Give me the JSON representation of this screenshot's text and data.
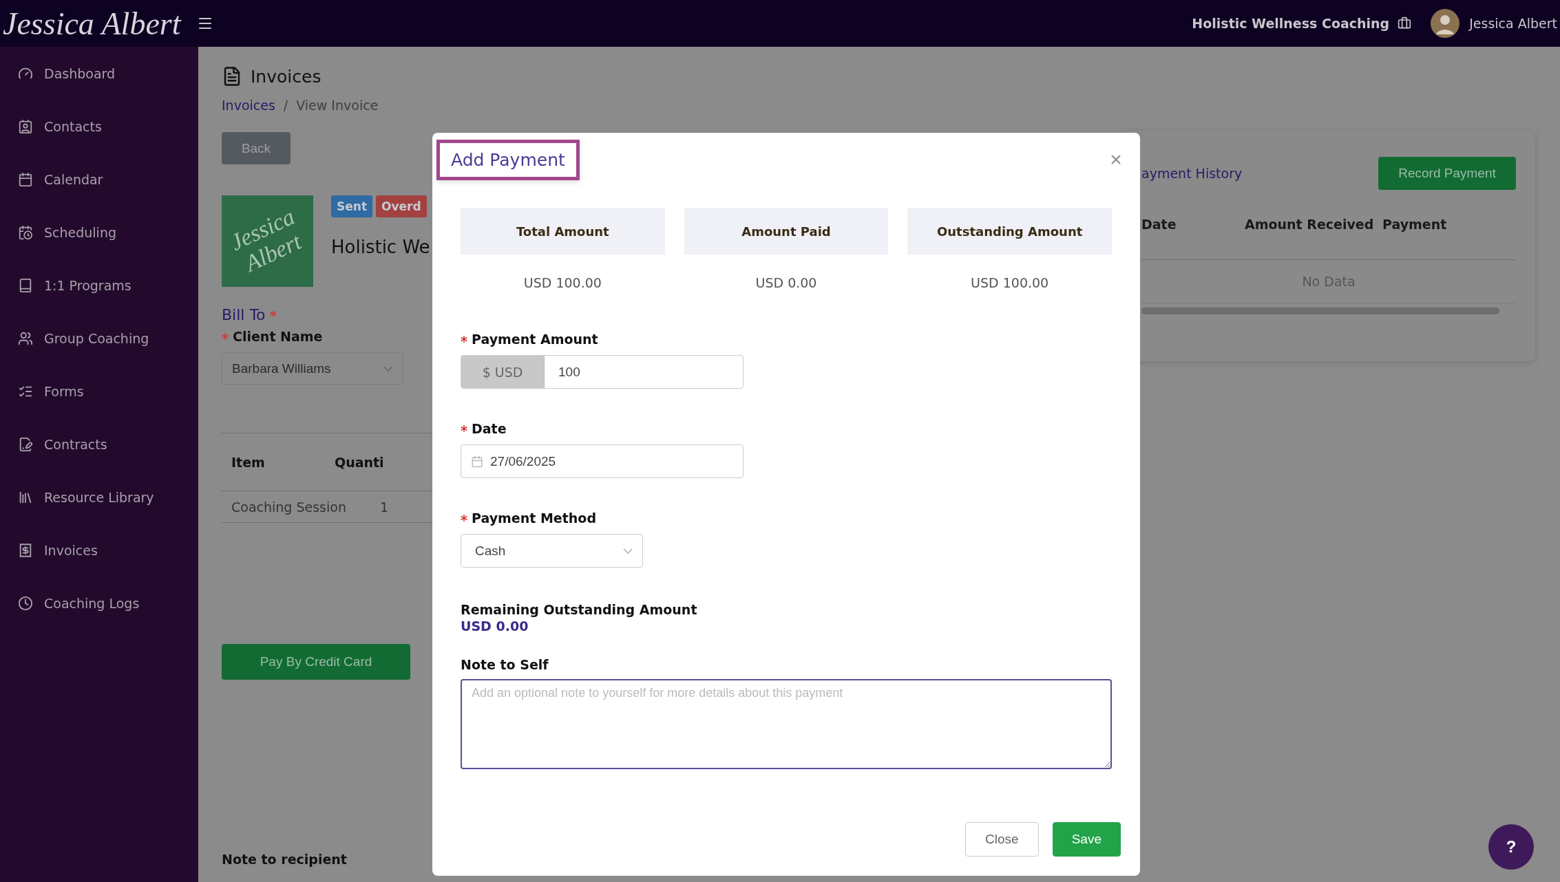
{
  "top_bar": {
    "logo": "Jessica Albert",
    "business": "Holistic Wellness Coaching",
    "user": "Jessica Albert"
  },
  "sidebar": {
    "items": [
      {
        "label": "Dashboard"
      },
      {
        "label": "Contacts"
      },
      {
        "label": "Calendar"
      },
      {
        "label": "Scheduling"
      },
      {
        "label": "1:1 Programs"
      },
      {
        "label": "Group Coaching"
      },
      {
        "label": "Forms"
      },
      {
        "label": "Contracts"
      },
      {
        "label": "Resource Library"
      },
      {
        "label": "Invoices"
      },
      {
        "label": "Coaching Logs"
      }
    ]
  },
  "page": {
    "title": "Invoices",
    "breadcrumb": [
      {
        "label": "Invoices",
        "link": true
      },
      {
        "label": "/",
        "link": false
      },
      {
        "label": "View Invoice",
        "link": false
      }
    ],
    "back_button": "Back",
    "logo_text": "Jessica Albert",
    "badges": [
      {
        "label": "Sent",
        "color": "#2f6aa3"
      },
      {
        "label": "Overd",
        "color": "#a34141"
      }
    ],
    "business_name": "Holistic We",
    "bill_to": {
      "label": "Bill To",
      "required": true
    },
    "client": {
      "label": "Client Name",
      "required": true,
      "value": "Barbara Williams"
    },
    "table": {
      "columns": [
        "Item",
        "Quanti"
      ],
      "rows": [
        [
          "Coaching Session",
          "1"
        ]
      ]
    },
    "pay_button": "Pay By Credit Card",
    "note_label": "Note to recipient"
  },
  "payment_history": {
    "title": "ayment History",
    "button": "Record Payment",
    "columns": [
      "Date",
      "Amount Received",
      "Payment"
    ],
    "empty": "No Data"
  },
  "modal": {
    "title": "Add Payment",
    "summary": [
      {
        "label": "Total Amount",
        "value": "USD 100.00"
      },
      {
        "label": "Amount Paid",
        "value": "USD 0.00"
      },
      {
        "label": "Outstanding Amount",
        "value": "USD 100.00"
      }
    ],
    "amount": {
      "label": "Payment Amount",
      "required": true,
      "addon": "$ USD",
      "value": "100"
    },
    "date": {
      "label": "Date",
      "required": true,
      "value": "27/06/2025"
    },
    "method": {
      "label": "Payment Method",
      "required": true,
      "value": "Cash"
    },
    "remaining": {
      "label": "Remaining Outstanding Amount",
      "value": "USD 0.00"
    },
    "note": {
      "label": "Note to Self",
      "placeholder": "Add an optional note to yourself for more details about this payment"
    },
    "buttons": [
      {
        "label": "Close",
        "kind": "secondary"
      },
      {
        "label": "Save",
        "kind": "primary"
      }
    ]
  },
  "help_button": "?"
}
